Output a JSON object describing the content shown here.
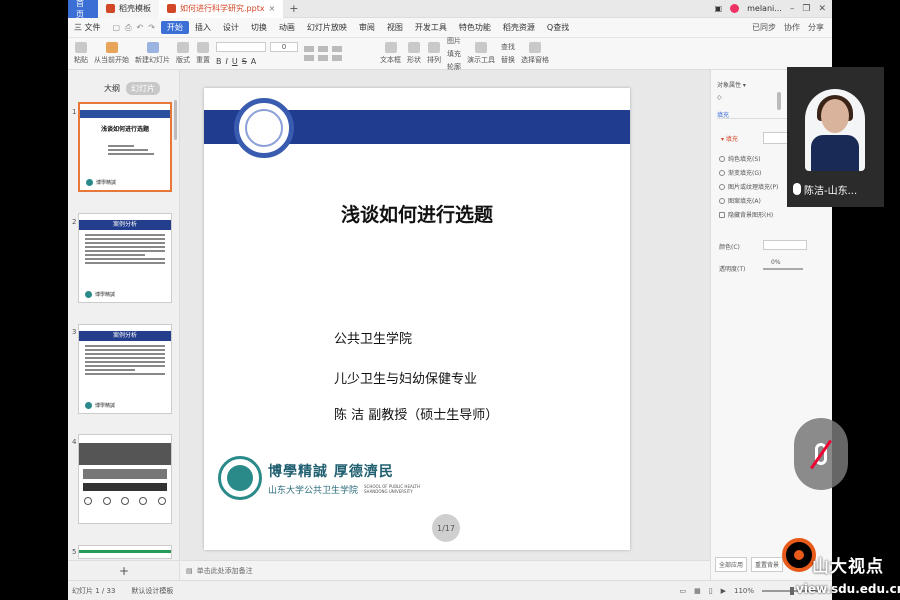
{
  "titlebar": {
    "home_tab": "首页",
    "tab2": "稻壳模板",
    "tab3": "如何进行科学研究.pptx",
    "user": "melani..."
  },
  "menubar": {
    "file": "三 文件",
    "items": [
      "开始",
      "插入",
      "设计",
      "切换",
      "动画",
      "幻灯片放映",
      "审阅",
      "视图",
      "开发工具",
      "特色功能",
      "稻壳资源"
    ],
    "search": "Q查找",
    "right": [
      "已同步",
      "协作",
      "分享"
    ]
  },
  "ribbon": {
    "paste": "粘贴",
    "from_current": "从当前开始",
    "new_slide": "新建幻灯片",
    "layout": "版式",
    "reset": "重置",
    "font_size": "0",
    "textbox": "文本框",
    "shape": "形状",
    "arrange": "排列",
    "picture": "图片",
    "fill": "填充",
    "outline": "轮廓",
    "present_tools": "演示工具",
    "find": "查找",
    "replace": "替换",
    "select_pane": "选择窗格"
  },
  "leftpanel": {
    "tab_outline": "大纲",
    "tab_slides": "幻灯片",
    "slide_numbers": [
      "1",
      "2",
      "3",
      "4",
      "5"
    ],
    "thumb1_title": "浅谈如何进行选题",
    "thumb2_title": "案例分析",
    "thumb3_title": "案例分析"
  },
  "slide": {
    "title": "浅谈如何进行选题",
    "line1": "公共卫生学院",
    "line2": "儿少卫生与妇幼保健专业",
    "line3": "陈 洁  副教授（硕士生导师）",
    "motto": "博學精誠  厚德濟民",
    "school_cn": "山东大学公共卫生学院",
    "school_en1": "SCHOOL OF PUBLIC HEALTH",
    "school_en2": "SHANDONG UNIVERSITY",
    "page": "1/17"
  },
  "notes": {
    "placeholder": "单击此处添加备注"
  },
  "rightpanel": {
    "title": "对象属性 ▾",
    "tab": "填充",
    "section": "▾ 填充",
    "options": [
      "纯色填充(S)",
      "渐变填充(G)",
      "图片或纹理填充(P)",
      "图案填充(A)",
      "隐藏背景图形(H)"
    ],
    "color_label": "颜色(C)",
    "transparency_label": "透明度(T)",
    "transparency_value": "0%",
    "apply_all": "全部应用",
    "reset_bg": "重置背景"
  },
  "statusbar": {
    "slide_count": "幻灯片 1 / 33",
    "theme": "默认设计模板",
    "zoom": "110%"
  },
  "video": {
    "name": "陈洁-山东..."
  },
  "watermark": {
    "brand": "山大视点",
    "url": "view.sdu.edu.cn"
  }
}
